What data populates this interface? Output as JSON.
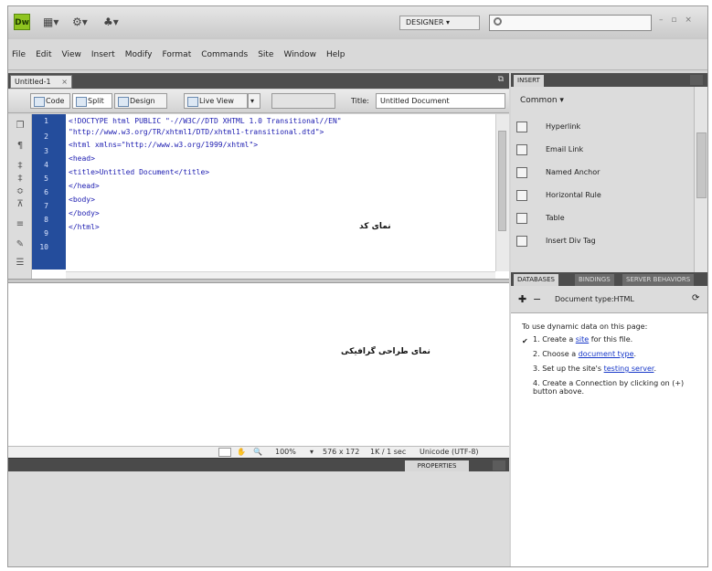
{
  "app": {
    "logo_text": "Dw",
    "workspace_label": "DESIGNER ▾",
    "search_placeholder": "",
    "window_controls": "– ▫ ×"
  },
  "menu": [
    "File",
    "Edit",
    "View",
    "Insert",
    "Modify",
    "Format",
    "Commands",
    "Site",
    "Window",
    "Help"
  ],
  "document": {
    "tab_label": "Untitled-1",
    "tab_close": "×",
    "toolbar": {
      "code_label": "Code",
      "split_label": "Split",
      "design_label": "Design",
      "live_view_label": "Live View",
      "title_label": "Title:",
      "title_value": "Untitled Document"
    },
    "line_numbers": [
      "1",
      "2",
      "3",
      "4",
      "5",
      "6",
      "7",
      "8",
      "9",
      "10"
    ],
    "code_lines": [
      "<!DOCTYPE html PUBLIC \"-//W3C//DTD XHTML 1.0 Transitional//EN\"",
      "\"http://www.w3.org/TR/xhtml1/DTD/xhtml1-transitional.dtd\">",
      "<html xmlns=\"http://www.w3.org/1999/xhtml\">",
      "<head>",
      "<title>Untitled Document</title>",
      "</head>",
      "<body>",
      "</body>",
      "</html>"
    ],
    "code_annotation": "نمای کد",
    "design_annotation": "نمای طراحی گرافیکی",
    "status": {
      "zoom": "100%",
      "size": "576 x 172",
      "download": "1K / 1 sec",
      "encoding": "Unicode (UTF-8)"
    },
    "properties_tab": "PROPERTIES"
  },
  "insert_panel": {
    "tab_label": "INSERT",
    "category": "Common ▾",
    "items": [
      {
        "label": "Hyperlink",
        "icon": "hyperlink-icon"
      },
      {
        "label": "Email Link",
        "icon": "email-icon"
      },
      {
        "label": "Named Anchor",
        "icon": "anchor-icon"
      },
      {
        "label": "Horizontal Rule",
        "icon": "rule-icon"
      },
      {
        "label": "Table",
        "icon": "table-icon"
      },
      {
        "label": "Insert Div Tag",
        "icon": "div-icon"
      }
    ]
  },
  "databases_panel": {
    "tabs": [
      "DATABASES",
      "BINDINGS",
      "SERVER BEHAVIORS"
    ],
    "document_type": "Document type:HTML",
    "intro": "To use dynamic data on this page:",
    "steps": [
      {
        "num": "1.",
        "pre": "Create a ",
        "link": "site",
        "post": " for this file."
      },
      {
        "num": "2.",
        "pre": "Choose a ",
        "link": "document type",
        "post": "."
      },
      {
        "num": "3.",
        "pre": "Set up the site's ",
        "link": "testing server",
        "post": "."
      },
      {
        "num": "4.",
        "pre": "Create a Connection by clicking on (+) button above.",
        "link": "",
        "post": ""
      }
    ]
  },
  "colors": {
    "gutter": "#244d9c",
    "code_text": "#1b1bb0",
    "link": "#1536c8",
    "logo": "#8fc420"
  }
}
